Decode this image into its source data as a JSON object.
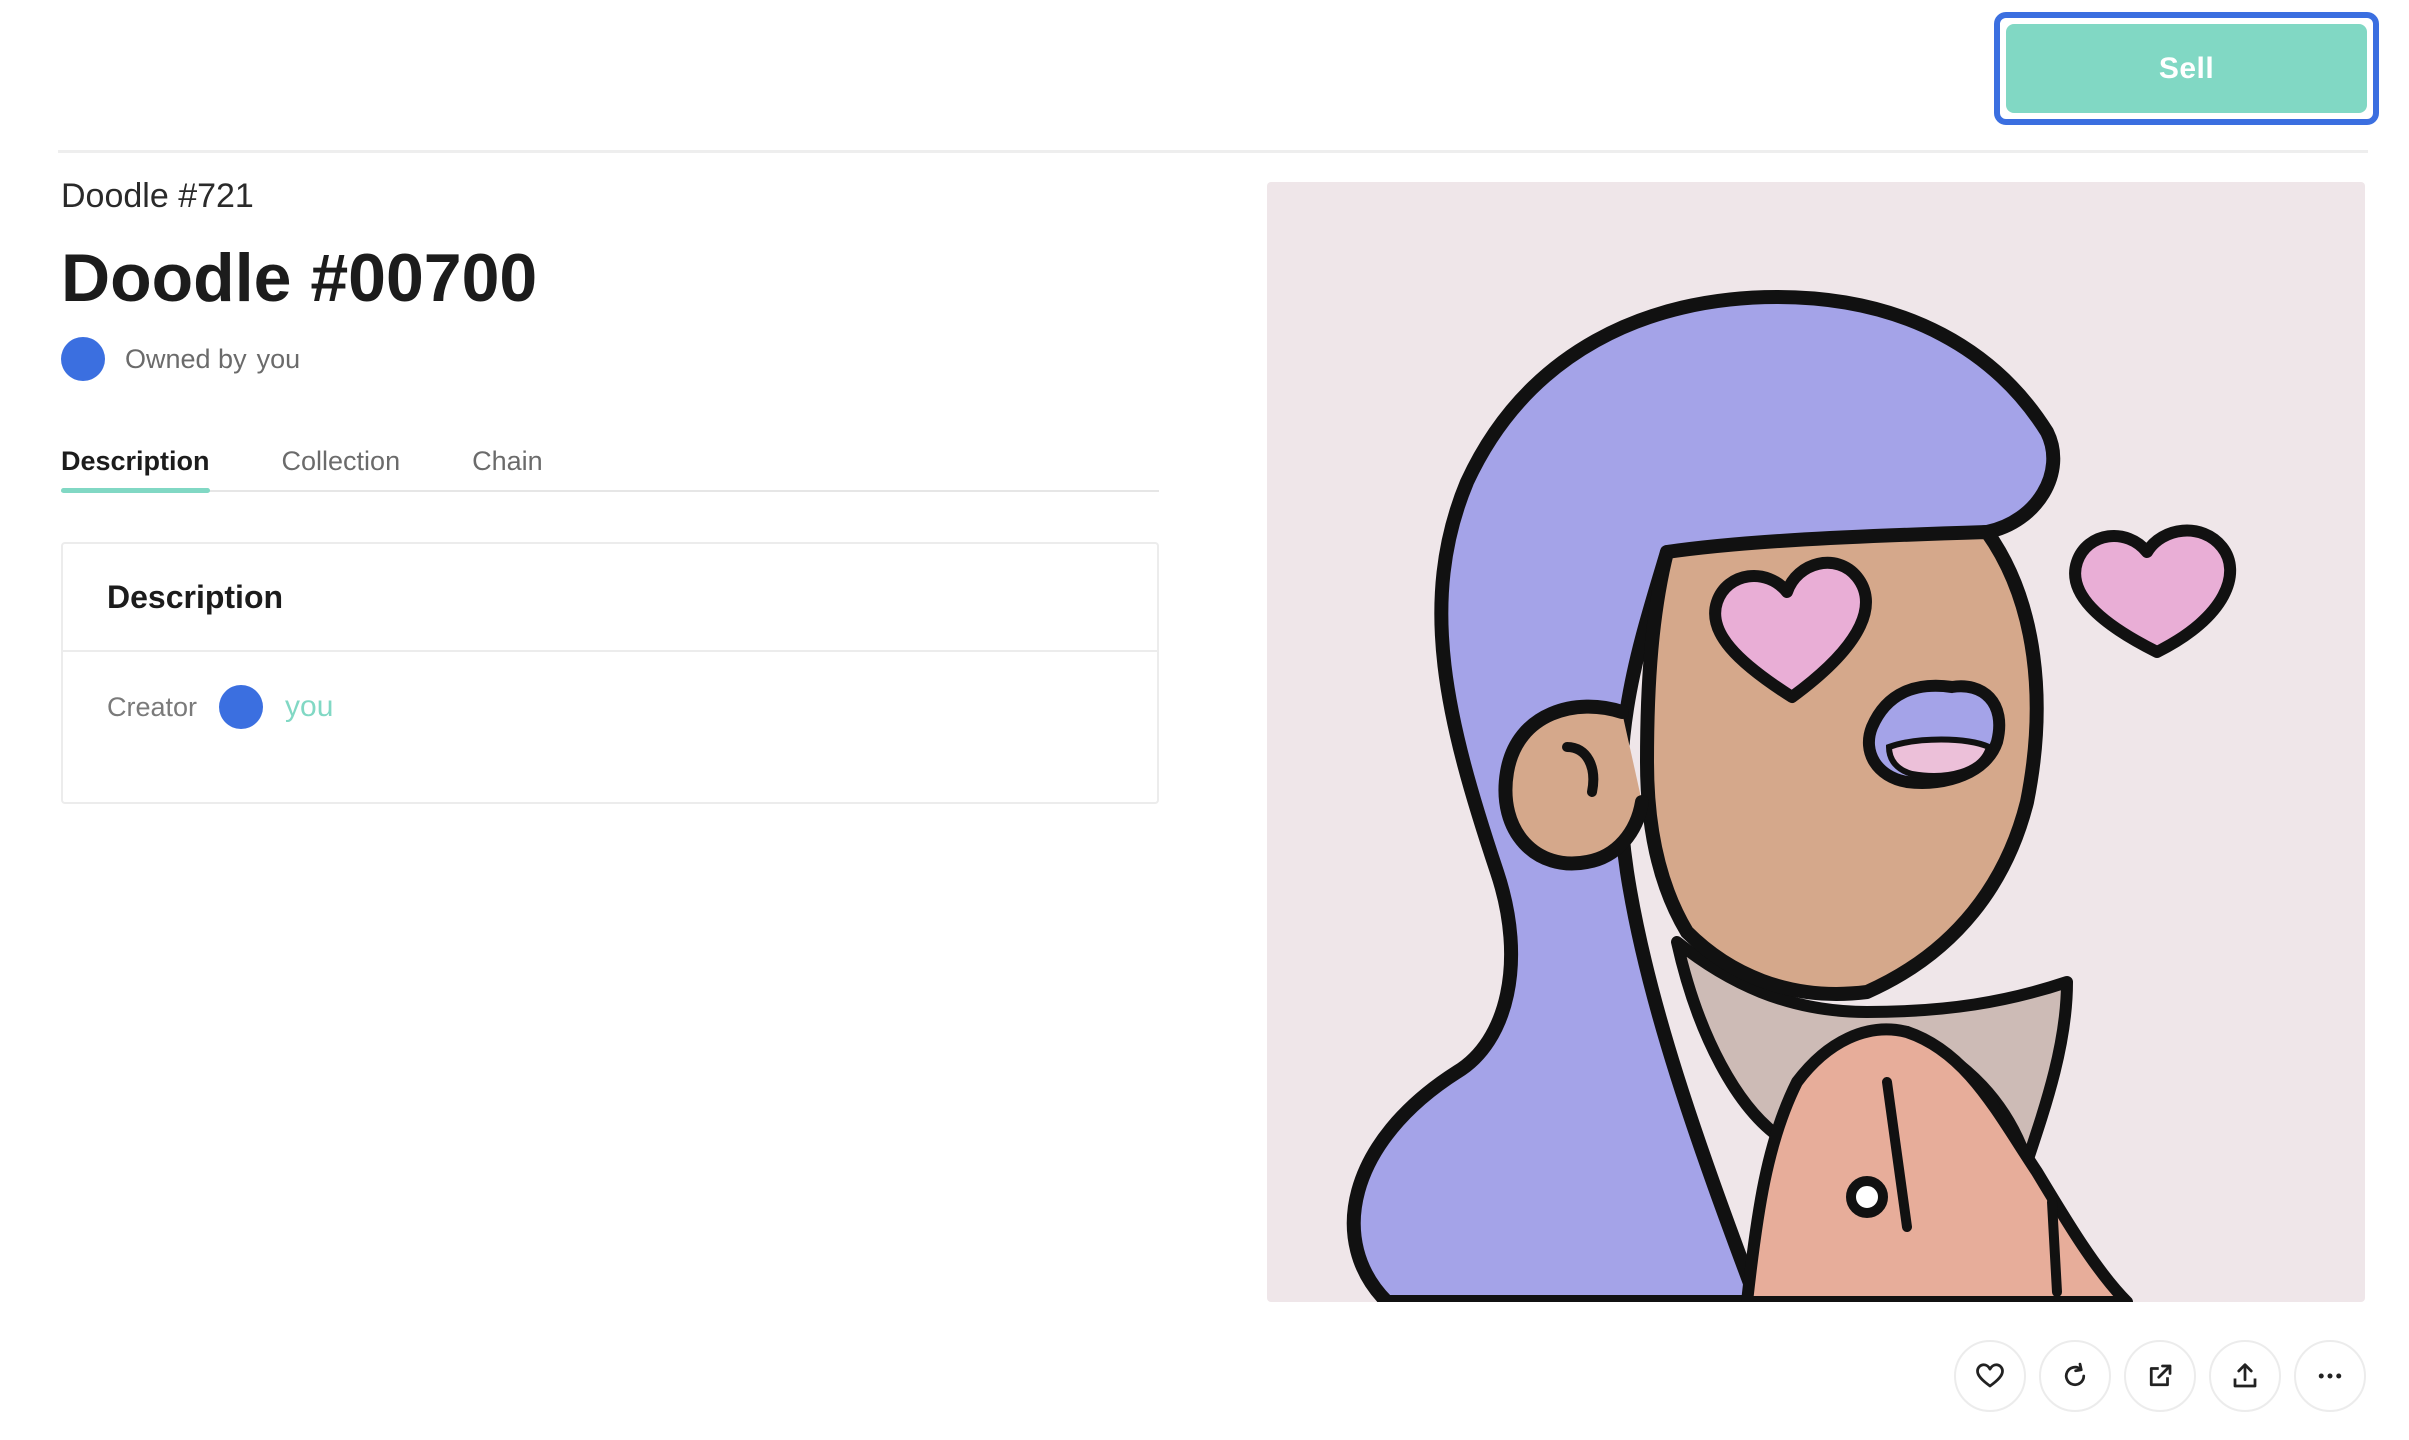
{
  "header": {
    "sell_label": "Sell"
  },
  "asset": {
    "collection_name": "Doodle #721",
    "title": "Doodle #00700",
    "owned_by_label": "Owned by",
    "owner": "you"
  },
  "tabs": [
    {
      "label": "Description",
      "active": true
    },
    {
      "label": "Collection",
      "active": false
    },
    {
      "label": "Chain",
      "active": false
    }
  ],
  "description_card": {
    "heading": "Description",
    "creator_label": "Creator",
    "creator_name": "you"
  },
  "artwork": {
    "alt": "doodle-character-artwork"
  },
  "actions": [
    {
      "icon": "heart-icon"
    },
    {
      "icon": "refresh-icon"
    },
    {
      "icon": "external-link-icon"
    },
    {
      "icon": "share-icon"
    },
    {
      "icon": "more-icon"
    }
  ],
  "colors": {
    "accent": "#81d8c4",
    "avatar": "#3b6fe0",
    "focus_ring": "#3b6fe0",
    "artwork_bg": "#efe6e9",
    "hair": "#a4a3e8",
    "skin": "#d5a88b",
    "heart": "#e9aed6"
  }
}
